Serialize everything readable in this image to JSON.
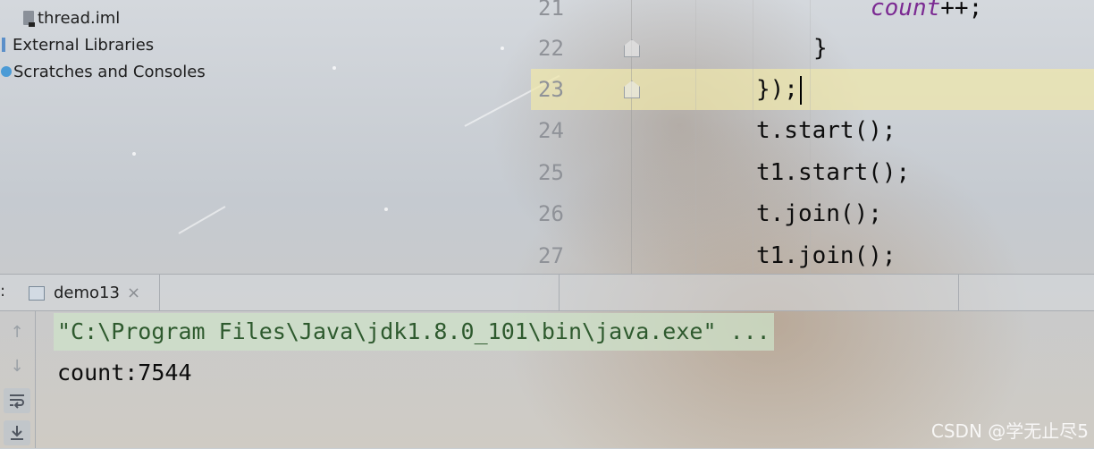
{
  "project_tree": {
    "items": [
      {
        "label": "thread.iml",
        "icon": "file-icon"
      },
      {
        "label": "External Libraries",
        "icon": "library-icon"
      },
      {
        "label": "Scratches and Consoles",
        "icon": "scratches-icon"
      }
    ]
  },
  "editor": {
    "current_line": "23",
    "lines": [
      {
        "number": "21",
        "text": "count",
        "suffix": "++;"
      },
      {
        "number": "22",
        "text": "}"
      },
      {
        "number": "23",
        "text": "});"
      },
      {
        "number": "24",
        "text": "t.start();"
      },
      {
        "number": "25",
        "text": "t1.start();"
      },
      {
        "number": "26",
        "text": "t.join();"
      },
      {
        "number": "27",
        "text": "t1.join();"
      }
    ]
  },
  "run_panel": {
    "tab_label": "demo13",
    "close_glyph": "×",
    "colon": ":",
    "tools": [
      "up-arrow-icon",
      "down-arrow-icon",
      "soft-wrap-icon",
      "scroll-to-end-icon"
    ],
    "console": {
      "command": "\"C:\\Program Files\\Java\\jdk1.8.0_101\\bin\\java.exe\" ...",
      "output": "count:7544"
    }
  },
  "watermark": "CSDN @学无止尽5",
  "colors": {
    "field": "#7b2a92",
    "line_highlight": "#f0e8aa",
    "command_bg": "#cde1c8"
  }
}
